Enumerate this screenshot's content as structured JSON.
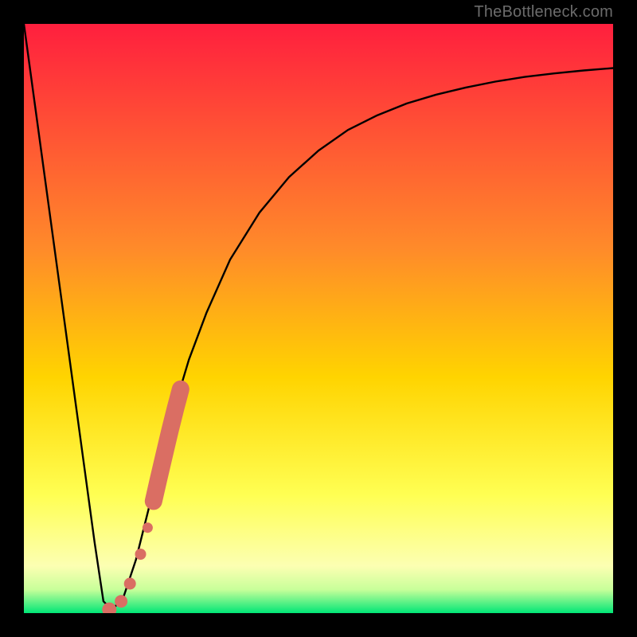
{
  "watermark": "TheBottleneck.com",
  "colors": {
    "black": "#000000",
    "curve": "#000000",
    "marker": "#DA6E63",
    "gradient_top": "#FF1F3E",
    "gradient_mid_high": "#FF6E2A",
    "gradient_mid": "#FFD400",
    "gradient_mid_low": "#FFFF53",
    "gradient_pale": "#FCFFB2",
    "gradient_green": "#00E676"
  },
  "chart_data": {
    "type": "line",
    "title": "",
    "xlabel": "",
    "ylabel": "",
    "xlim": [
      0,
      100
    ],
    "ylim": [
      0,
      100
    ],
    "series": [
      {
        "name": "bottleneck-curve",
        "x": [
          0,
          3,
          6,
          9,
          12,
          13.5,
          15,
          17,
          19,
          22,
          25,
          28,
          31,
          35,
          40,
          45,
          50,
          55,
          60,
          65,
          70,
          75,
          80,
          85,
          90,
          95,
          100
        ],
        "values": [
          100,
          78,
          56,
          34,
          12,
          2,
          0.5,
          3,
          9,
          21,
          33,
          43,
          51,
          60,
          68,
          74,
          78.5,
          82,
          84.5,
          86.5,
          88,
          89.2,
          90.2,
          91,
          91.6,
          92.1,
          92.5
        ]
      }
    ],
    "optimum_x": 14.5,
    "markers": {
      "name": "data-points-right-branch",
      "x": [
        16.5,
        18.0,
        19.8,
        21.0,
        22.0,
        22.8,
        23.5,
        24.2,
        24.8,
        25.3,
        25.8,
        26.2,
        26.6
      ],
      "y": [
        2.0,
        5.0,
        10.0,
        14.5,
        19.0,
        22.5,
        25.5,
        28.5,
        31.0,
        33.0,
        35.0,
        36.5,
        38.0
      ]
    }
  }
}
